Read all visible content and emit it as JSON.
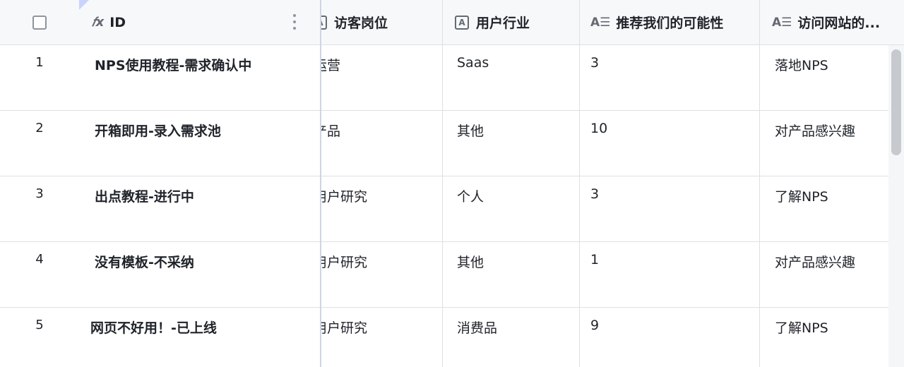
{
  "header": {
    "id_icon": "𝑓x",
    "id_label": "ID",
    "position_icon": "A",
    "position_label": "访客岗位",
    "industry_icon": "A",
    "industry_label": "用户行业",
    "recommend_icon": "A☰",
    "recommend_label": "推荐我们的可能性",
    "visit_icon": "A☰",
    "visit_label": "访问网站的..."
  },
  "rows": [
    {
      "num": "1",
      "id": "NPS使用教程-需求确认中",
      "position": "运营",
      "industry": "Saas",
      "recommend": "3",
      "visit": "落地NPS"
    },
    {
      "num": "2",
      "id": "开箱即用-录入需求池",
      "position": "产品",
      "industry": "其他",
      "recommend": "10",
      "visit": "对产品感兴趣"
    },
    {
      "num": "3",
      "id": "出点教程-进行中",
      "position": "用户研究",
      "industry": "个人",
      "recommend": "3",
      "visit": "了解NPS"
    },
    {
      "num": "4",
      "id": "没有模板-不采纳",
      "position": "用户研究",
      "industry": "其他",
      "recommend": "1",
      "visit": "对产品感兴趣"
    },
    {
      "num": "5",
      "id": "网页不好用！-已上线",
      "position": "用户研究",
      "industry": "消费品",
      "recommend": "9",
      "visit": "了解NPS"
    }
  ],
  "colors": {
    "border": "#dee0e3",
    "header_bg": "#f7f8fa",
    "accent": "#c9d3ff"
  }
}
